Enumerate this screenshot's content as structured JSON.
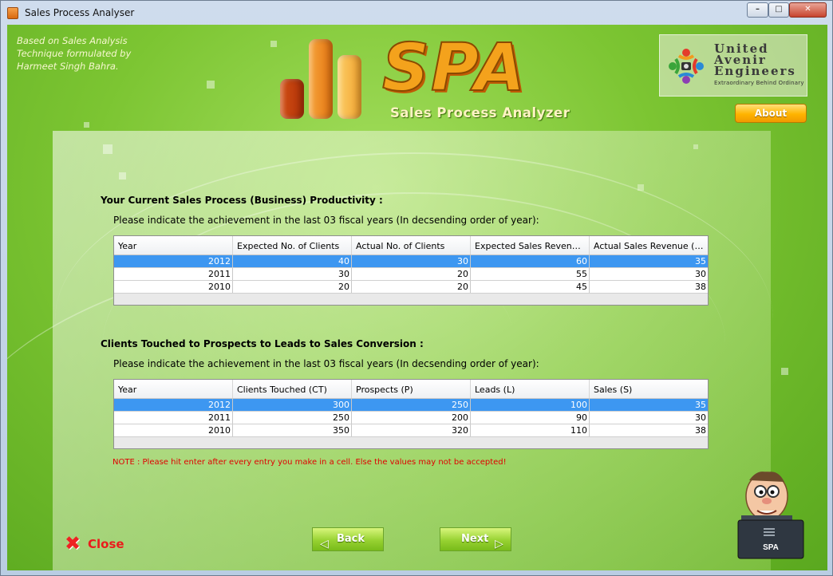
{
  "window": {
    "title": "Sales Process Analyser"
  },
  "header": {
    "credit": "Based on Sales Analysis Technique formulated by Harmeet Singh Bahra.",
    "logo_text": "SPA",
    "logo_subtitle": "Sales Process Analyzer",
    "company_name": "United\nAvenir\nEngineers",
    "company_tagline": "Extraordinary  Behind  Ordinary",
    "about_label": "About"
  },
  "productivity": {
    "title": "Your Current Sales Process (Business) Productivity :",
    "subtitle": "Please indicate the achievement in the last 03 fiscal years (In decsending order of year):",
    "columns": [
      "Year",
      "Expected No. of Clients",
      "Actual No. of Clients",
      "Expected Sales Revenue (...",
      "Actual Sales Revenue (Cr)"
    ],
    "rows": [
      [
        "2012",
        "40",
        "30",
        "60",
        "35"
      ],
      [
        "2011",
        "30",
        "20",
        "55",
        "30"
      ],
      [
        "2010",
        "20",
        "20",
        "45",
        "38"
      ]
    ]
  },
  "conversion": {
    "title": "Clients Touched to Prospects to Leads to Sales Conversion :",
    "subtitle": "Please indicate the achievement in the last 03 fiscal years (In decsending order of year):",
    "columns": [
      "Year",
      "Clients Touched (CT)",
      "Prospects (P)",
      "Leads (L)",
      "Sales (S)"
    ],
    "rows": [
      [
        "2012",
        "300",
        "250",
        "100",
        "35"
      ],
      [
        "2011",
        "250",
        "200",
        "90",
        "30"
      ],
      [
        "2010",
        "350",
        "320",
        "110",
        "38"
      ]
    ]
  },
  "note": "NOTE : Please hit enter after every entry you make in a cell. Else the values may not be accepted!",
  "footer": {
    "close_label": "Close",
    "back_label": "Back",
    "next_label": "Next",
    "mascot_label": "SPA"
  },
  "colors": {
    "accent_green": "#7cc532",
    "selection_blue": "#3d97f1",
    "note_red": "#e00000",
    "about_orange": "#ffb400"
  }
}
